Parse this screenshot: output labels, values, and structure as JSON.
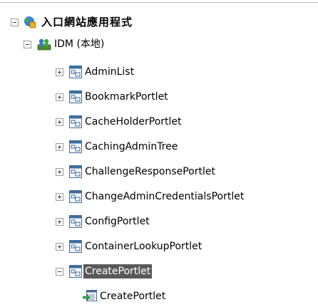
{
  "tree": {
    "root": {
      "label": "入口網站應用程式",
      "expanded": true,
      "icon": "globe-app-icon"
    },
    "server": {
      "label": "IDM (本地)",
      "expanded": true,
      "icon": "server-users-icon"
    },
    "portlets": [
      {
        "label": "AdminList",
        "expanded": false
      },
      {
        "label": "BookmarkPortlet",
        "expanded": false
      },
      {
        "label": "CacheHolderPortlet",
        "expanded": false
      },
      {
        "label": "CachingAdminTree",
        "expanded": false
      },
      {
        "label": "ChallengeResponsePortlet",
        "expanded": false
      },
      {
        "label": "ChangeAdminCredentialsPortlet",
        "expanded": false
      },
      {
        "label": "ConfigPortlet",
        "expanded": false
      },
      {
        "label": "ContainerLookupPortlet",
        "expanded": false
      },
      {
        "label": "CreatePortlet",
        "expanded": true,
        "selected": true
      }
    ],
    "child": {
      "label": "CreatePortlet",
      "icon": "portlet-instance-icon"
    }
  }
}
